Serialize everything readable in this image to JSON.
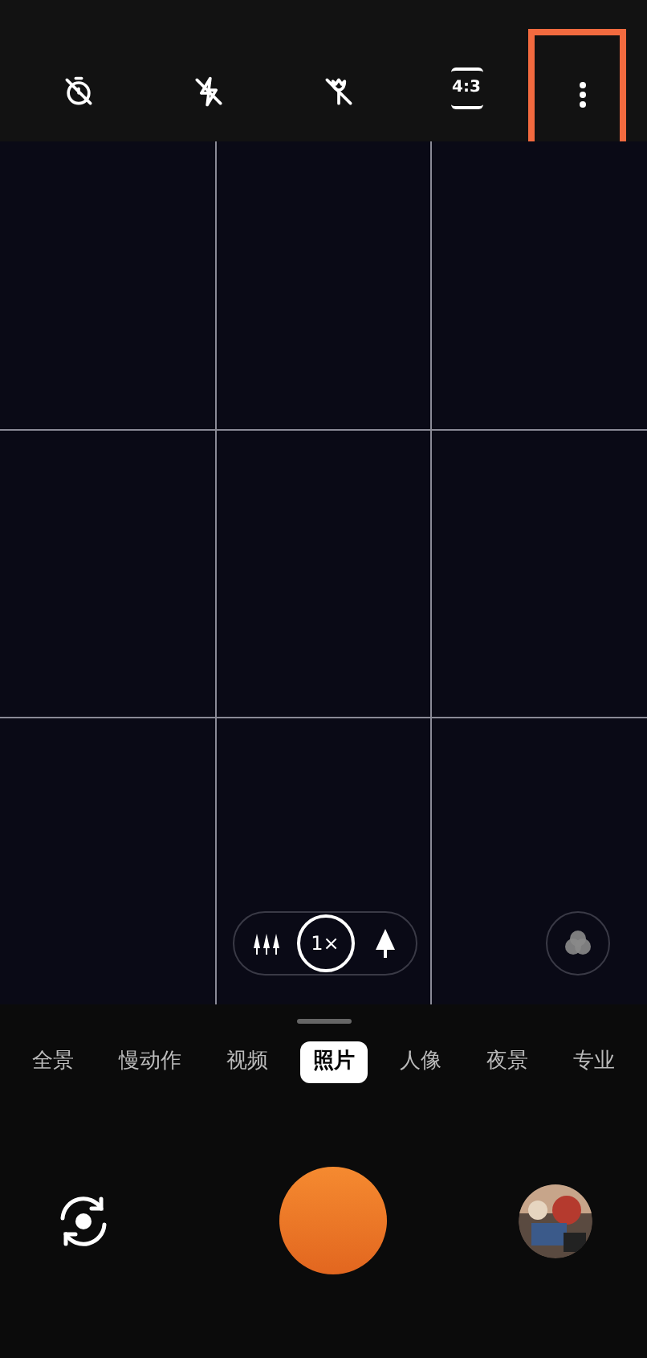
{
  "top_bar": {
    "aspect_ratio": "4:3"
  },
  "zoom": {
    "options": [
      {
        "kind": "wide",
        "selected": false
      },
      {
        "kind": "label",
        "label": "1×",
        "selected": true
      },
      {
        "kind": "tele",
        "selected": false
      }
    ]
  },
  "modes": [
    {
      "label": "全景",
      "selected": false
    },
    {
      "label": "慢动作",
      "selected": false
    },
    {
      "label": "视频",
      "selected": false
    },
    {
      "label": "照片",
      "selected": true
    },
    {
      "label": "人像",
      "selected": false
    },
    {
      "label": "夜景",
      "selected": false
    },
    {
      "label": "专业",
      "selected": false
    }
  ],
  "highlight": {
    "on": true
  }
}
